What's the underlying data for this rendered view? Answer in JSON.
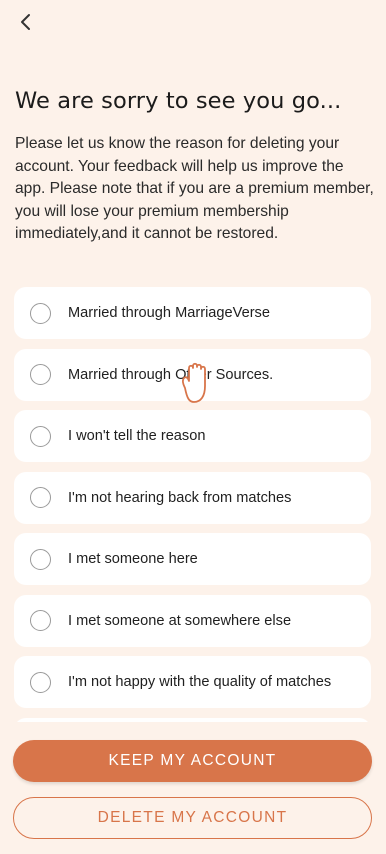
{
  "header": {
    "back_icon": "chevron-left-icon"
  },
  "title": "We are sorry to see you go...",
  "description": "Please let us know the reason for deleting your account. Your feedback will help us improve the app. Please note that if you are a premium member, you will lose your premium membership immediately,and it cannot be restored.",
  "options": [
    {
      "label": "Married through MarriageVerse"
    },
    {
      "label": "Married through Other Sources."
    },
    {
      "label": "I won't tell the reason"
    },
    {
      "label": "I'm not hearing back from matches"
    },
    {
      "label": "I met someone here"
    },
    {
      "label": "I met someone at somewhere else"
    },
    {
      "label": "I'm not happy with the quality of matches"
    },
    {
      "label": ""
    }
  ],
  "buttons": {
    "keep": "KEEP MY ACCOUNT",
    "delete": "DELETE MY ACCOUNT"
  },
  "colors": {
    "accent": "#d8754a",
    "background": "#fdf2ea"
  }
}
